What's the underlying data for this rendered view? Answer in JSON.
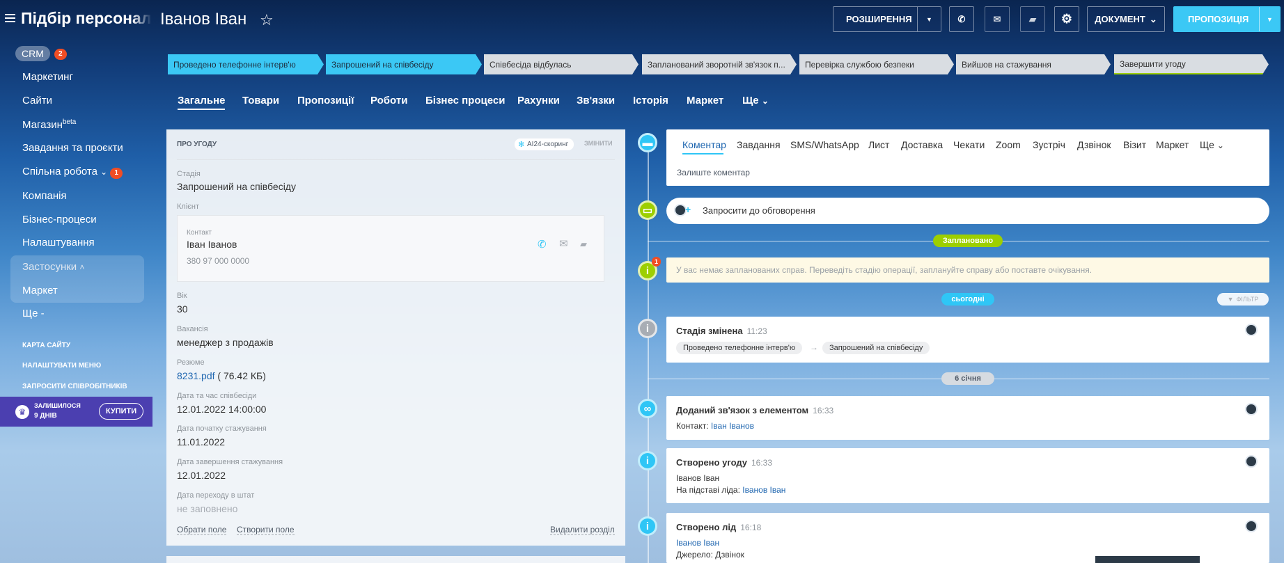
{
  "header": {
    "app_title": "Підбір персоналу",
    "deal_title": "Іванов Іван",
    "btn_extensions": "РОЗШИРЕННЯ",
    "btn_document": "ДОКУМЕНТ",
    "btn_proposal": "ПРОПОЗИЦІЯ"
  },
  "sidebar": {
    "crm": "CRM",
    "crm_badge": "2",
    "items": [
      "Маркетинг",
      "Сайти",
      "Магазин",
      "Завдання та проєкти",
      "Спільна робота",
      "Компанія",
      "Бізнес-процеси",
      "Налаштування",
      "Застосунки",
      "Маркет",
      "Ще -"
    ],
    "shop_sup": "beta",
    "collab_badge": "1",
    "links": [
      "КАРТА САЙТУ",
      "НАЛАШТУВАТИ МЕНЮ",
      "ЗАПРОСИТИ СПІВРОБІТНИКІВ"
    ],
    "trial": "ЗАЛИШИЛОСЯ",
    "trial_days": "9 ДНІВ",
    "buy": "КУПИТИ"
  },
  "stages": [
    "Проведено телефонне інтерв'ю",
    "Запрошений на співбесіду",
    "Співбесіда відбулась",
    "Запланований зворотній зв'язок п...",
    "Перевірка службою безпеки",
    "Вийшов на стажування",
    "Завершити угоду"
  ],
  "tabs": [
    "Загальне",
    "Товари",
    "Пропозиції",
    "Роботи",
    "Бізнес процеси",
    "Рахунки",
    "Зв'язки",
    "Історія",
    "Маркет",
    "Ще"
  ],
  "about": {
    "heading": "ПРО УГОДУ",
    "ai": "AI24-скоринг",
    "change": "ЗМІНИТИ",
    "stage_label": "Стадія",
    "stage_value": "Запрошений на співбесіду",
    "client_label": "Клієнт",
    "contact_label": "Контакт",
    "contact_name": "Іван Іванов",
    "contact_phone": "380 97 000 0000",
    "age_label": "Вік",
    "age_value": "30",
    "vacancy_label": "Вакансія",
    "vacancy_value": "менеджер з продажів",
    "resume_label": "Резюме",
    "resume_file": "8231.pdf",
    "resume_size": "( 76.42 КБ)",
    "interview_label": "Дата та час співбесіди",
    "interview_value": "12.01.2022 14:00:00",
    "intern_start_label": "Дата початку стажування",
    "intern_start_value": "11.01.2022",
    "intern_end_label": "Дата завершення стажування",
    "intern_end_value": "12.01.2022",
    "staff_label": "Дата переходу в штат",
    "staff_value": "не заповнено",
    "choose_field": "Обрати поле",
    "create_field": "Створити поле",
    "delete_section": "Видалити розділ"
  },
  "activity_tabs": [
    "Коментар",
    "Завдання",
    "SMS/WhatsApp",
    "Лист",
    "Доставка",
    "Чекати",
    "Zoom",
    "Зустріч",
    "Дзвінок",
    "Візит",
    "Маркет",
    "Ще"
  ],
  "comment_placeholder": "Залиште коментар",
  "discuss": "Запросити до обговорення",
  "planned": "Заплановано",
  "no_tasks": "У вас немає запланованих справ. Переведіть стадію операції, заплануйте справу або поставте очікування.",
  "no_tasks_badge": "1",
  "today": "сьогодні",
  "filter": "ФІЛЬТР",
  "date_sep": "6 січня",
  "events": [
    {
      "title": "Стадія змінена",
      "time": "11:23",
      "from": "Проведено телефонне інтерв'ю",
      "to": "Запрошений на співбесіду"
    },
    {
      "title": "Доданий зв'язок з елементом",
      "time": "16:33",
      "line1": "Контакт:",
      "link": "Іван Іванов"
    },
    {
      "title": "Створено угоду",
      "time": "16:33",
      "line1": "Іванов Іван",
      "line2": "На підставі ліда:",
      "link": "Іванов Іван"
    },
    {
      "title": "Створено лід",
      "time": "16:18",
      "link": "Іванов Іван",
      "line2": "Джерело: Дзвінок"
    }
  ],
  "colors": {
    "accent": "#3bc8f5",
    "green": "#9dcf00",
    "badge": "#f04d24"
  }
}
